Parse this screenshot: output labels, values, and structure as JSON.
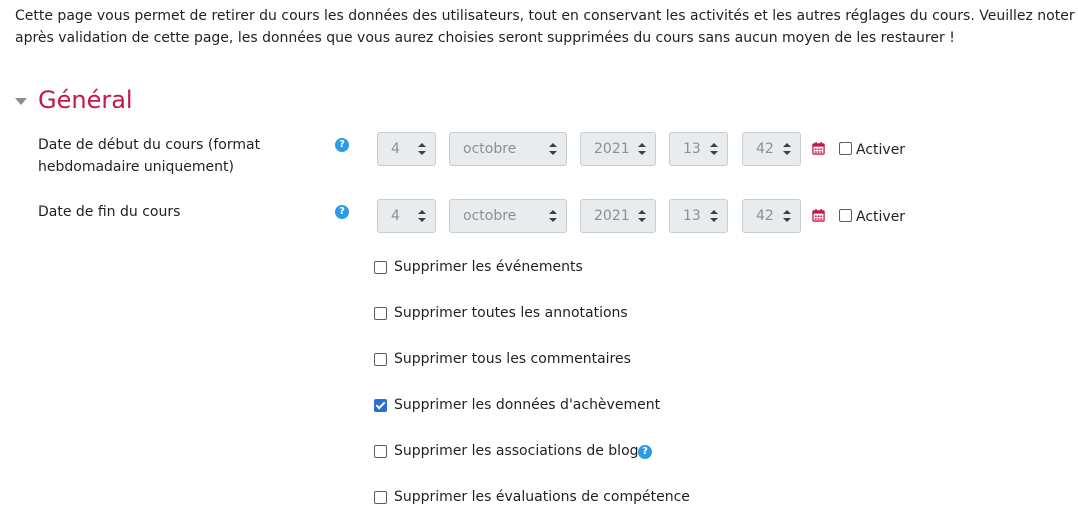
{
  "intro": {
    "line1": "Cette page vous permet de retirer du cours les données des utilisateurs, tout en conservant les activités et les autres réglages du cours. Veuillez noter qu'en c",
    "line2": "après validation de cette page, les données que vous aurez choisies seront supprimées du cours sans aucun moyen de les restaurer !"
  },
  "section": {
    "title": "Général"
  },
  "start_date": {
    "label_line1": "Date de début du cours (format",
    "label_line2": "hebdomadaire uniquement)",
    "day": "4",
    "month": "octobre",
    "year": "2021",
    "hour": "13",
    "minute": "42",
    "enable_label": "Activer"
  },
  "end_date": {
    "label": "Date de fin du cours",
    "day": "4",
    "month": "octobre",
    "year": "2021",
    "hour": "13",
    "minute": "42",
    "enable_label": "Activer"
  },
  "help_glyph": "?",
  "options": [
    {
      "label": "Supprimer les événements",
      "checked": false
    },
    {
      "label": "Supprimer toutes les annotations",
      "checked": false
    },
    {
      "label": "Supprimer tous les commentaires",
      "checked": false
    },
    {
      "label": "Supprimer les données d'achèvement",
      "checked": true
    },
    {
      "label": "Supprimer les associations de blog",
      "checked": false
    },
    {
      "label": "Supprimer les évaluations de compétence",
      "checked": false
    }
  ],
  "colors": {
    "accent": "#c6164a",
    "help": "#2d9be5",
    "checkbox_checked": "#2b6fd6"
  }
}
